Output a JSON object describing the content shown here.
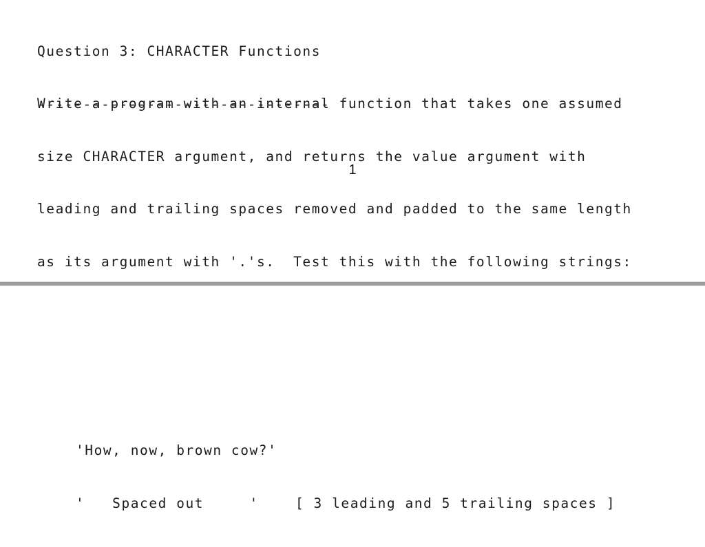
{
  "document": {
    "page_one": {
      "heading": {
        "title": "Question 3: CHARACTER Functions",
        "rule": "--------------------------------"
      },
      "body": {
        "line1": "Write a program with an internal function that takes one assumed",
        "line2": "size CHARACTER argument, and returns the value argument with",
        "line3": "leading and trailing spaces removed and padded to the same length",
        "line4": "as its argument with '.'s.  Test this with the following strings:"
      },
      "page_number": "1"
    },
    "page_two": {
      "test_strings": {
        "line1": "'How, now, brown cow?'",
        "line2": "'   Spaced out     '    [ 3 leading and 5 trailing spaces ]"
      }
    }
  },
  "colors": {
    "background": "#ffffff",
    "text": "#1b1b1b",
    "divider": "#9d9d9d"
  }
}
